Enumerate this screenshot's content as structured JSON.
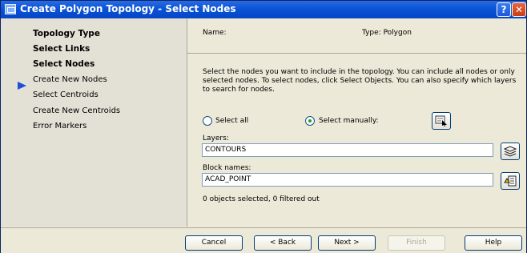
{
  "window": {
    "title": "Create Polygon Topology - Select Nodes",
    "help_label": "?",
    "close_label": "✕"
  },
  "sidebar": {
    "items": [
      {
        "label": "Topology Type"
      },
      {
        "label": "Select Links"
      },
      {
        "label": "Select Nodes"
      },
      {
        "label": "Create New Nodes"
      },
      {
        "label": "Select Centroids"
      },
      {
        "label": "Create New Centroids"
      },
      {
        "label": "Error Markers"
      }
    ],
    "current_index": 2
  },
  "main": {
    "name_label": "Name:",
    "type_label": "Type: Polygon",
    "description": "Select the nodes you want to include in the topology. You can include all nodes or only selected nodes. To select nodes, click Select Objects. You can also specify which layers to search for nodes.",
    "radio_all_label": "Select all",
    "radio_manual_label": "Select manually:",
    "selected_mode": "manual",
    "layers_label": "Layers:",
    "layers_value": "CONTOURS",
    "block_names_label": "Block names:",
    "block_names_value": "ACAD_POINT",
    "status_text": "0 objects selected, 0 filtered out"
  },
  "icons": {
    "select_objects": "select-objects-icon",
    "layers_browse": "layers-browse-icon",
    "block_browse": "block-browse-icon"
  },
  "footer": {
    "cancel_label": "Cancel",
    "back_label": "< Back",
    "next_label": "Next >",
    "finish_label": "Finish",
    "help_label": "Help"
  },
  "colors": {
    "title_bar": "#0a54d8",
    "current_step_arrow": "#1c4fd6",
    "dialog_background": "#ece9d8"
  }
}
